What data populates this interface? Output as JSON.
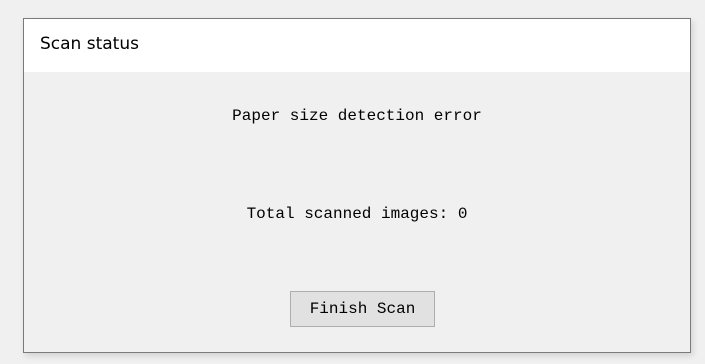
{
  "dialog": {
    "title": "Scan status",
    "error_message": "Paper size detection error",
    "total_label": "Total scanned images: 0",
    "finish_button_label": "Finish Scan"
  }
}
